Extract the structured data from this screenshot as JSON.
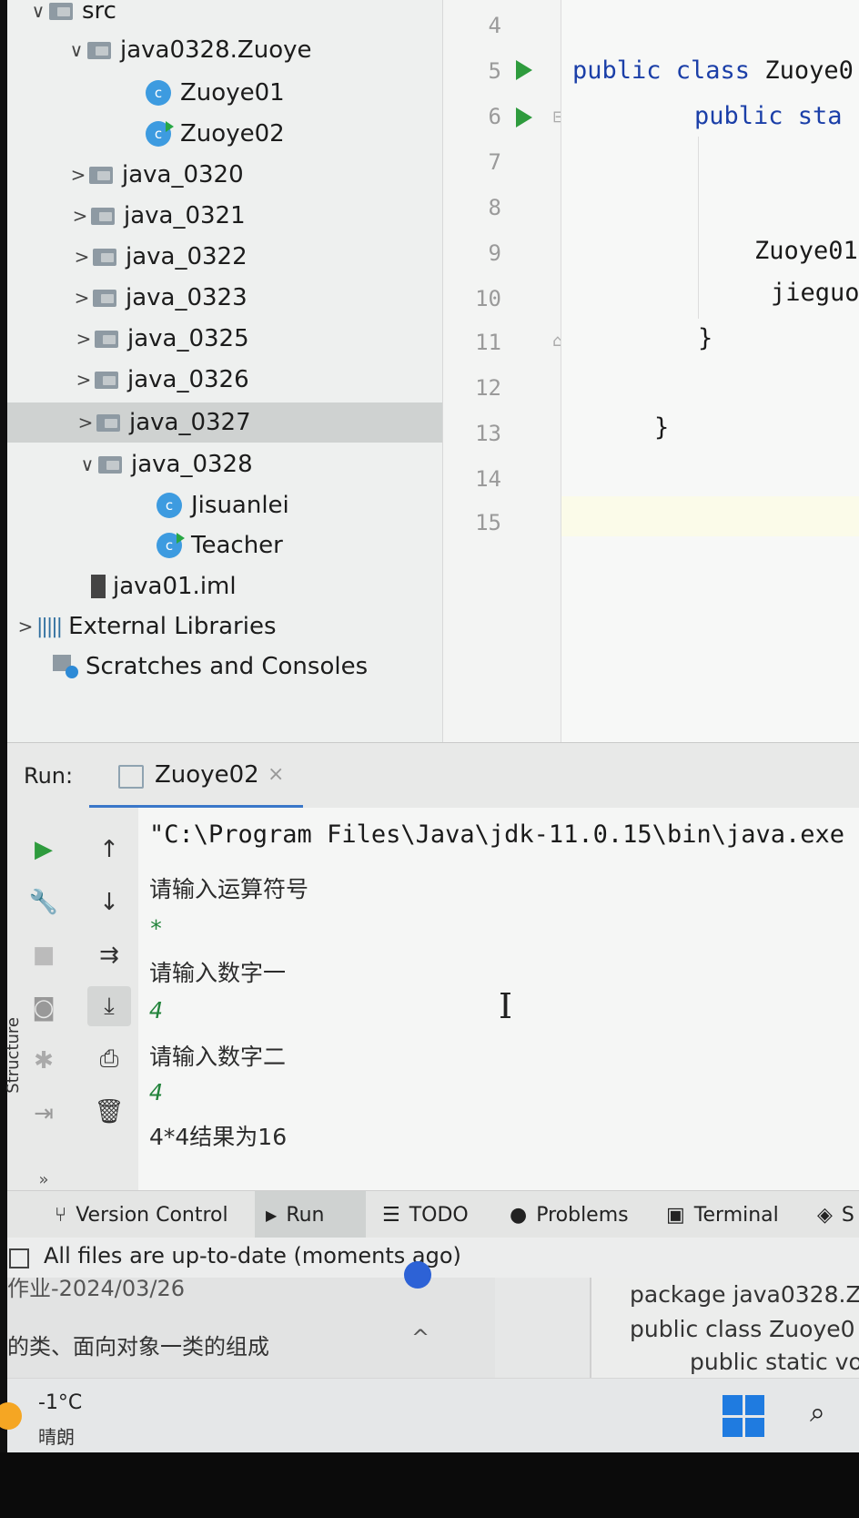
{
  "project_tree": {
    "items": [
      {
        "label": "src",
        "kind": "folder",
        "chevron": "∨"
      },
      {
        "label": "java0328.Zuoye",
        "kind": "package",
        "chevron": "∨"
      },
      {
        "label": "Zuoye01",
        "kind": "class",
        "icon_letter": "c"
      },
      {
        "label": "Zuoye02",
        "kind": "class-run",
        "icon_letter": "c"
      },
      {
        "label": "java_0320",
        "kind": "package",
        "chevron": ">"
      },
      {
        "label": "java_0321",
        "kind": "package",
        "chevron": ">"
      },
      {
        "label": "java_0322",
        "kind": "package",
        "chevron": ">"
      },
      {
        "label": "java_0323",
        "kind": "package",
        "chevron": ">"
      },
      {
        "label": "java_0325",
        "kind": "package",
        "chevron": ">"
      },
      {
        "label": "java_0326",
        "kind": "package",
        "chevron": ">"
      },
      {
        "label": "java_0327",
        "kind": "package",
        "chevron": ">",
        "selected": true
      },
      {
        "label": "java_0328",
        "kind": "package",
        "chevron": "∨"
      },
      {
        "label": "Jisuanlei",
        "kind": "class",
        "icon_letter": "c"
      },
      {
        "label": "Teacher",
        "kind": "class-run",
        "icon_letter": "c"
      },
      {
        "label": "java01.iml",
        "kind": "iml"
      },
      {
        "label": "External Libraries",
        "kind": "libraries",
        "chevron": ">"
      },
      {
        "label": "Scratches and Consoles",
        "kind": "scratches"
      }
    ]
  },
  "editor": {
    "line_numbers": [
      "4",
      "5",
      "6",
      "7",
      "8",
      "9",
      "10",
      "11",
      "12",
      "13",
      "14",
      "15"
    ],
    "code": {
      "line5_kw": "public class ",
      "line5_name": "Zuoye0",
      "line6_kw": "public sta",
      "line9": "Zuoye01",
      "line10": "jieguo",
      "line11": "}",
      "line13": "}"
    }
  },
  "run_panel": {
    "label": "Run:",
    "tab": {
      "name": "Zuoye02",
      "close": "×"
    },
    "console_lines": [
      {
        "text": "\"C:\\Program Files\\Java\\jdk-11.0.15\\bin\\java.exe",
        "type": "cmd"
      },
      {
        "text": "请输入运算符号",
        "type": "output"
      },
      {
        "text": "*",
        "type": "input"
      },
      {
        "text": "请输入数字一",
        "type": "output"
      },
      {
        "text": "4",
        "type": "input"
      },
      {
        "text": "请输入数字二",
        "type": "output"
      },
      {
        "text": "4",
        "type": "input"
      },
      {
        "text": "4*4结果为16",
        "type": "output"
      }
    ],
    "side_label": "Structure",
    "more": "»"
  },
  "tool_windows": [
    {
      "label": "Version Control",
      "icon": "version-control-icon"
    },
    {
      "label": "Run",
      "icon": "run-icon",
      "active": true
    },
    {
      "label": "TODO",
      "icon": "todo-icon"
    },
    {
      "label": "Problems",
      "icon": "problems-icon"
    },
    {
      "label": "Terminal",
      "icon": "terminal-icon"
    },
    {
      "label": "S",
      "icon": "services-icon"
    }
  ],
  "status_bar": {
    "text": "All files are up-to-date (moments ago)"
  },
  "background_window": {
    "left_line1": "作业-2024/03/26",
    "left_line2": "的类、面向对象一类的组成",
    "caret": "^",
    "right_lines": [
      "package java0328.Z",
      "public class Zuoye0",
      "public static vo"
    ]
  },
  "taskbar": {
    "temperature": "-1°C",
    "condition": "晴朗"
  },
  "colors": {
    "accent": "#3a77c9",
    "run_green": "#2e9b3d",
    "keyword_blue": "#1b3fa8",
    "console_input_green": "#23843c"
  }
}
